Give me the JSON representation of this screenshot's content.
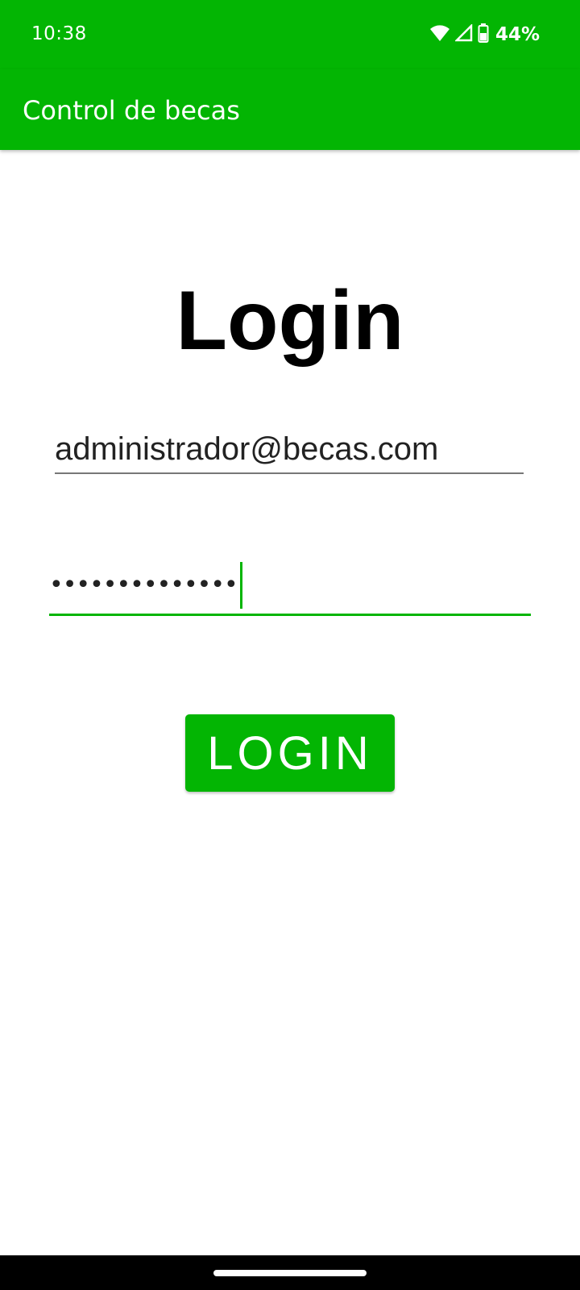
{
  "status_bar": {
    "time": "10:38",
    "battery_percent": "44%",
    "icons": [
      "wifi-icon",
      "cell-signal-icon",
      "battery-icon"
    ]
  },
  "app_bar": {
    "title": "Control de becas"
  },
  "login": {
    "heading": "Login",
    "email_value": "administrador@becas.com",
    "password_masked": "••••••••••••••",
    "button_label": "LOGIN"
  },
  "colors": {
    "primary": "#03b503",
    "text": "#000000",
    "background": "#ffffff"
  }
}
